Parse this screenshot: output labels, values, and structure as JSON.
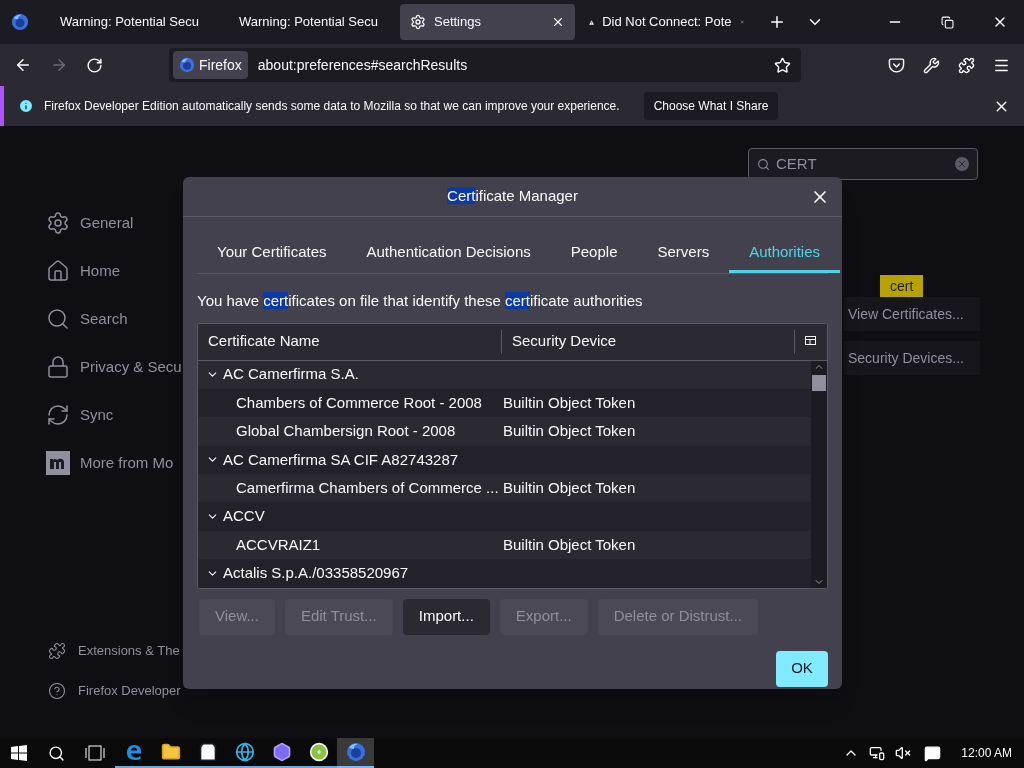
{
  "tabs": [
    {
      "title": "Warning: Potential Secu",
      "kind": "warning",
      "selected": false
    },
    {
      "title": "Warning: Potential Secu",
      "kind": "warning",
      "selected": false
    },
    {
      "title": "Settings",
      "kind": "settings",
      "selected": true
    },
    {
      "title": "Did Not Connect: Pote",
      "kind": "warning",
      "selected": false
    }
  ],
  "nav": {
    "identity": "Firefox",
    "url": "about:preferences#searchResults"
  },
  "notification": {
    "message": "Firefox Developer Edition automatically sends some data to Mozilla so that we can improve your experience.",
    "button": "Choose What I Share"
  },
  "search": {
    "value": "CERT"
  },
  "sidebar": {
    "items": [
      {
        "label": "General",
        "kind": "general"
      },
      {
        "label": "Home",
        "kind": "home"
      },
      {
        "label": "Search",
        "kind": "search"
      },
      {
        "label": "Privacy & Secu",
        "kind": "privacy"
      },
      {
        "label": "Sync",
        "kind": "sync"
      },
      {
        "label": "More from Mo",
        "kind": "more"
      }
    ],
    "footer": [
      {
        "label": "Extensions & The",
        "kind": "extensions"
      },
      {
        "label": "Firefox Developer",
        "kind": "help"
      }
    ]
  },
  "results": {
    "tooltip": "cert",
    "buttons": [
      {
        "label": "View Certificates..."
      },
      {
        "label": "Security Devices..."
      }
    ]
  },
  "dialog": {
    "title": [
      {
        "text": "Cert",
        "highlight": true
      },
      {
        "text": "ificate Manager",
        "highlight": false
      }
    ],
    "tabs": [
      {
        "label": "Your Certificates",
        "selected": false
      },
      {
        "label": "Authentication Decisions",
        "selected": false
      },
      {
        "label": "People",
        "selected": false
      },
      {
        "label": "Servers",
        "selected": false
      },
      {
        "label": "Authorities",
        "selected": true
      }
    ],
    "description": [
      {
        "text": "You have ",
        "highlight": false
      },
      {
        "text": "cert",
        "highlight": true
      },
      {
        "text": "ificates on file that identify these ",
        "highlight": false
      },
      {
        "text": "cert",
        "highlight": true
      },
      {
        "text": "ificate authorities",
        "highlight": false
      }
    ],
    "columns": [
      "Certificate Name",
      "Security Device"
    ],
    "rows": [
      {
        "kind": "group",
        "name": "AC Camerfirma S.A.",
        "expanded": true
      },
      {
        "kind": "cert",
        "name": "Chambers of Commerce Root - 2008",
        "device": "Builtin Object Token"
      },
      {
        "kind": "cert",
        "name": "Global Chambersign Root - 2008",
        "device": "Builtin Object Token"
      },
      {
        "kind": "group",
        "name": "AC Camerfirma SA CIF A82743287",
        "expanded": true
      },
      {
        "kind": "cert",
        "name": "Camerfirma Chambers of Commerce ...",
        "device": "Builtin Object Token"
      },
      {
        "kind": "group",
        "name": "ACCV",
        "expanded": true
      },
      {
        "kind": "cert",
        "name": "ACCVRAIZ1",
        "device": "Builtin Object Token"
      },
      {
        "kind": "group",
        "name": "Actalis S.p.A./03358520967",
        "expanded": true
      }
    ],
    "buttons": [
      {
        "label": "View...",
        "disabled": true
      },
      {
        "label": "Edit Trust...",
        "disabled": true
      },
      {
        "label": "Import...",
        "disabled": false
      },
      {
        "label": "Export...",
        "disabled": true
      },
      {
        "label": "Delete or Distrust...",
        "disabled": true
      }
    ],
    "ok": "OK"
  },
  "taskbar": {
    "apps": [
      {
        "kind": "legacy-browser",
        "active": false
      },
      {
        "kind": "files",
        "active": false
      },
      {
        "kind": "store",
        "active": false
      },
      {
        "kind": "browser",
        "active": false
      },
      {
        "kind": "assistant",
        "active": false
      },
      {
        "kind": "app",
        "active": false
      },
      {
        "kind": "firefox",
        "active": true
      }
    ],
    "clock": "12:00 AM"
  }
}
